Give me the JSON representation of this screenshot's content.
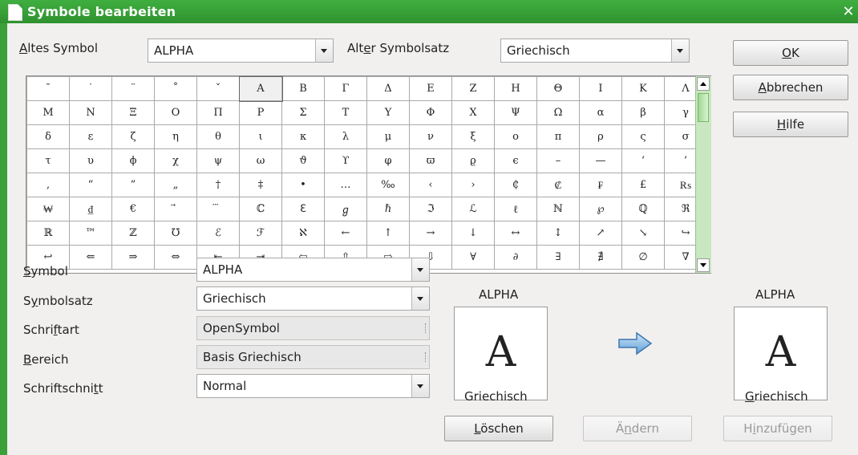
{
  "window": {
    "title": "Symbole bearbeiten",
    "close_label": "✕"
  },
  "top": {
    "old_symbol_label": "Altes Symbol",
    "old_symbol_value": "ALPHA",
    "old_set_label": "Alter Symbolsatz",
    "old_set_value": "Griechisch"
  },
  "buttons": {
    "ok": "OK",
    "cancel": "Abbrechen",
    "help": "Hilfe",
    "delete": "Löschen",
    "modify": "Ändern",
    "add": "Hinzufügen"
  },
  "grid": {
    "rows": [
      [
        "˘",
        "˙",
        "¨",
        "˚",
        "ˇ",
        "Α",
        "Β",
        "Γ",
        "Δ",
        "Ε",
        "Ζ",
        "Η",
        "Θ",
        "Ι",
        "Κ",
        "Λ"
      ],
      [
        "Μ",
        "Ν",
        "Ξ",
        "Ο",
        "Π",
        "Ρ",
        "Σ",
        "Τ",
        "Υ",
        "Φ",
        "Χ",
        "Ψ",
        "Ω",
        "α",
        "β",
        "γ"
      ],
      [
        "δ",
        "ε",
        "ζ",
        "η",
        "θ",
        "ι",
        "κ",
        "λ",
        "μ",
        "ν",
        "ξ",
        "ο",
        "π",
        "ρ",
        "ς",
        "σ"
      ],
      [
        "τ",
        "υ",
        "ϕ",
        "χ",
        "ψ",
        "ω",
        "ϑ",
        "ϒ",
        "φ",
        "ϖ",
        "ϱ",
        "ϵ",
        "–",
        "—",
        "‘",
        "’"
      ],
      [
        "‚",
        "“",
        "”",
        "„",
        "†",
        "‡",
        "•",
        "…",
        "‰",
        "‹",
        "›",
        "₵",
        "₡",
        "₣",
        "£",
        "₨"
      ],
      [
        "₩",
        "₫",
        "€",
        "⃗",
        "⃛",
        "ℂ",
        "ℇ",
        "ℊ",
        "ℏ",
        "ℑ",
        "ℒ",
        "ℓ",
        "ℕ",
        "℘",
        "ℚ",
        "ℜ"
      ],
      [
        "ℝ",
        "™",
        "ℤ",
        "℧",
        "ℰ",
        "ℱ",
        "ℵ",
        "←",
        "↑",
        "→",
        "↓",
        "↔",
        "↕",
        "↗",
        "↘",
        "↪"
      ],
      [
        "↩",
        "⇐",
        "⇒",
        "⇔",
        "⇤",
        "⇥",
        "⇦",
        "⇧",
        "⇨",
        "⇩",
        "∀",
        "∂",
        "∃",
        "∄",
        "∅",
        "∇"
      ]
    ]
  },
  "form": {
    "symbol_label": "Symbol",
    "symbol_value": "ALPHA",
    "set_label": "Symbolsatz",
    "set_value": "Griechisch",
    "font_label": "Schriftart",
    "font_value": "OpenSymbol",
    "range_label": "Bereich",
    "range_value": "Basis Griechisch",
    "style_label": "Schriftschnitt",
    "style_value": "Normal"
  },
  "preview_old": {
    "name": "ALPHA",
    "glyph": "Α",
    "set": "Griechisch"
  },
  "preview_new": {
    "name": "ALPHA",
    "glyph": "Α",
    "set": "Griechisch"
  }
}
